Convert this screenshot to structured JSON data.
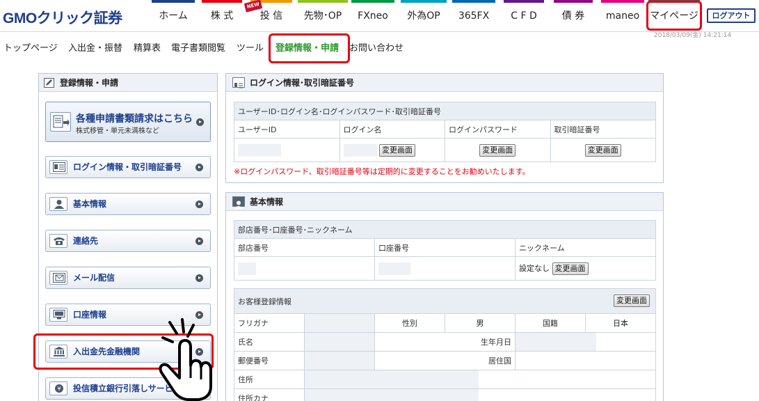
{
  "header": {
    "logo": "GMOクリック証券",
    "nav": [
      {
        "label": "ホーム",
        "color": "#1d3f8e"
      },
      {
        "label": "株 式",
        "color": "#e60012"
      },
      {
        "label": "投 信",
        "color": "#f39800"
      },
      {
        "label": "先物･OP",
        "color": "#8fc31f"
      },
      {
        "label": "FXneo",
        "color": "#009944"
      },
      {
        "label": "外為OP",
        "color": "#00a0c1"
      },
      {
        "label": "365FX",
        "color": "#0068b7"
      },
      {
        "label": "C F D",
        "color": "#601986"
      },
      {
        "label": "債 券",
        "color": "#920783"
      },
      {
        "label": "maneo",
        "color": "#e4007f"
      },
      {
        "label": "マイページ",
        "color": "#555555"
      }
    ],
    "new_badge": "NEW",
    "logout_label": "ログアウト",
    "timestamp": "2018/03/09(金) 14:21:14"
  },
  "subnav": [
    "トップページ",
    "入出金・振替",
    "精算表",
    "電子書類閲覧",
    "ツール",
    "登録情報・申請",
    "お問い合わせ"
  ],
  "subnav_active_color": "#2d9a2d",
  "sidebar": {
    "title": "登録情報・申請",
    "apply": {
      "title": "各種申請書類請求はこちら",
      "sub": "株式移管・単元未満株など"
    },
    "items": [
      {
        "label": "ログイン情報・取引暗証番号",
        "icon": "id-card-icon"
      },
      {
        "label": "基本情報",
        "icon": "person-icon"
      },
      {
        "label": "連絡先",
        "icon": "phone-icon"
      },
      {
        "label": "メール配信",
        "icon": "mail-icon"
      },
      {
        "label": "口座情報",
        "icon": "monitor-icon"
      },
      {
        "label": "入出金先金融機関",
        "icon": "bank-icon"
      },
      {
        "label": "投信積立銀行引落しサービス",
        "icon": "coin-icon"
      }
    ]
  },
  "login_panel": {
    "title": "ログイン情報･取引暗証番号",
    "section": "ユーザーID･ログイン名･ログインパスワード･取引暗証番号",
    "columns": [
      "ユーザーID",
      "ログイン名",
      "ログインパスワード",
      "取引暗証番号"
    ],
    "change_label": "変更画面",
    "notice": "※ログインパスワード、取引暗証番号等は定期的に変更することをお勧めいたします。"
  },
  "basic_panel": {
    "title": "基本情報",
    "section1": "部店番号･口座番号･ニックネーム",
    "columns1": [
      "部店番号",
      "口座番号",
      "ニックネーム"
    ],
    "nickname_value": "設定なし",
    "change_label": "変更画面",
    "section2": "お客様登録情報",
    "rows": {
      "furigana": "フリガナ",
      "gender_label": "性別",
      "gender_value": "男",
      "nationality_label": "国籍",
      "nationality_value": "日本",
      "name": "氏名",
      "birthdate": "生年月日",
      "postal": "郵便番号",
      "residence": "居住国",
      "address": "住所",
      "address_kana": "住所カナ"
    }
  }
}
